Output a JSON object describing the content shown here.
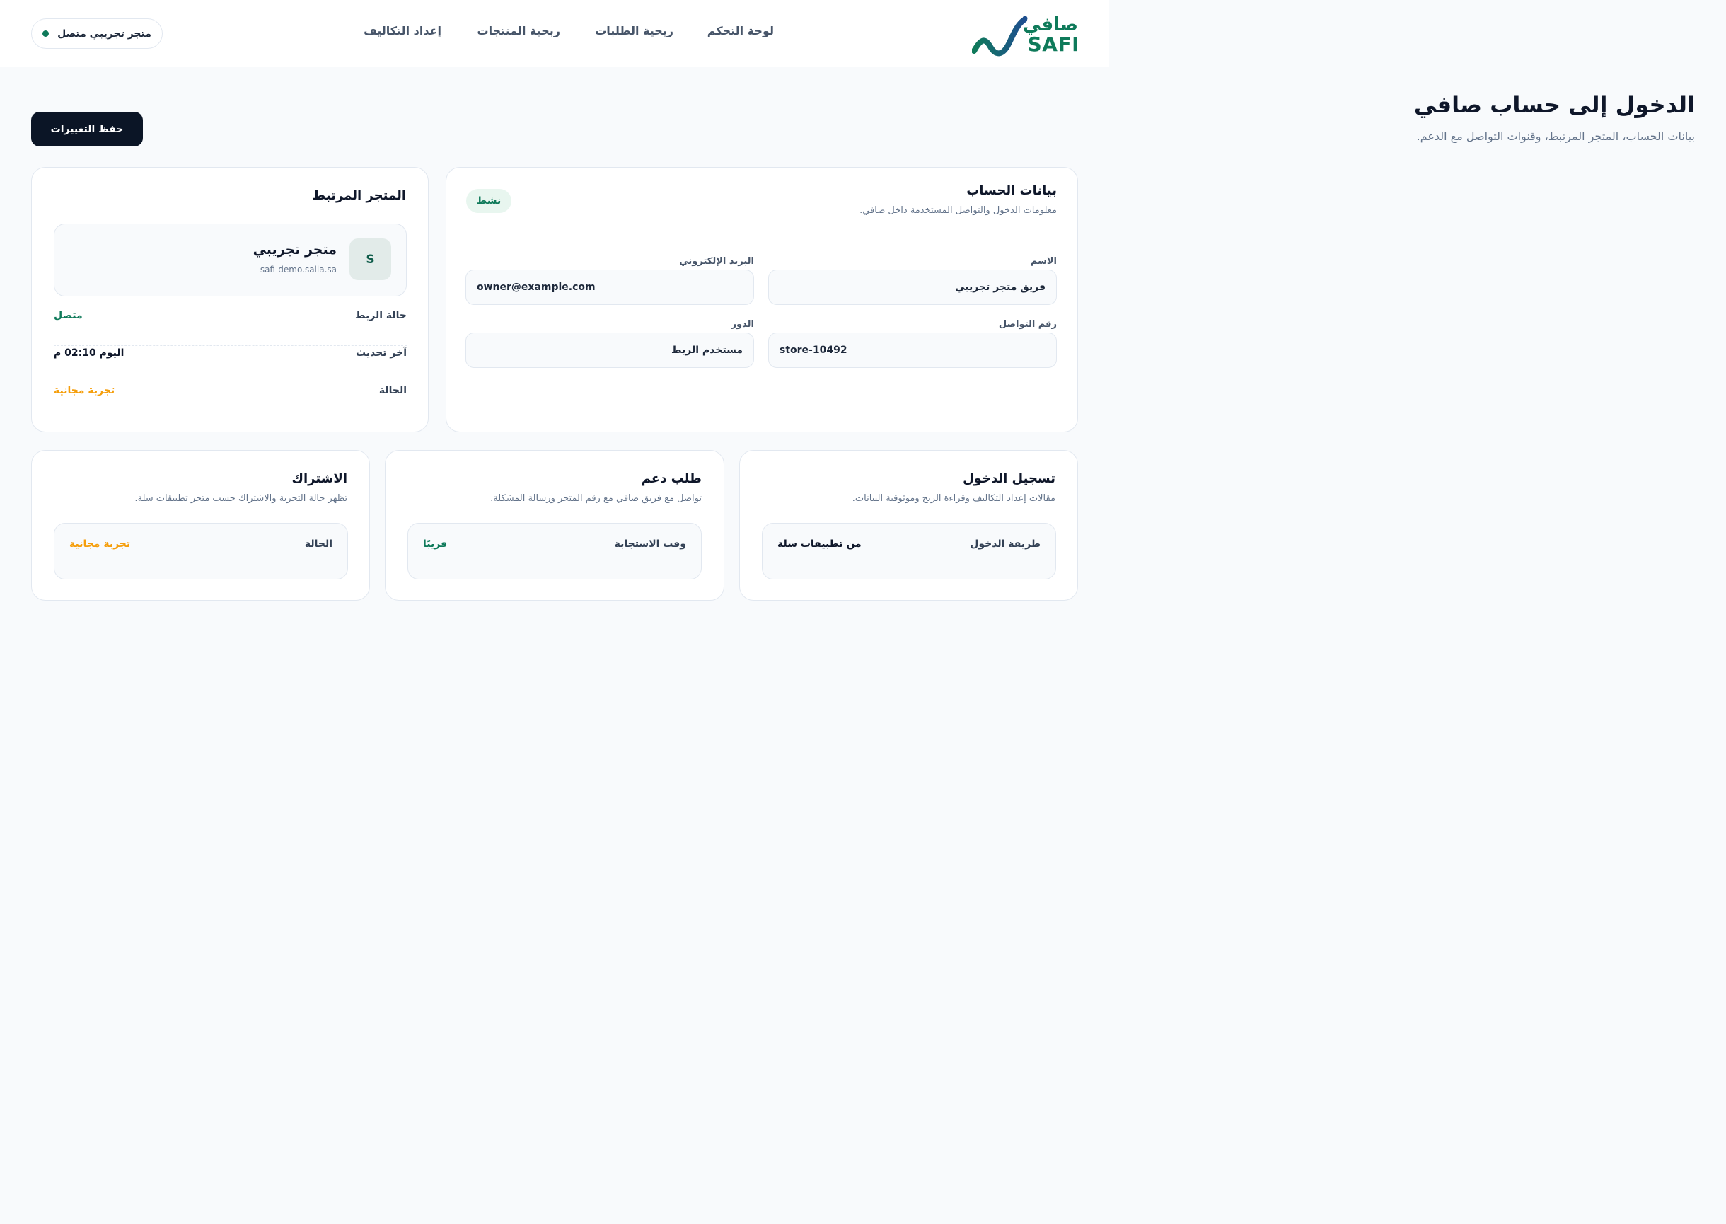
{
  "brand": {
    "name_ar": "صافي",
    "name_en": "SAFI",
    "color": "#0f7a5a",
    "mark_icon": "wave-logo-icon"
  },
  "nav": {
    "items": [
      {
        "label": "لوحة التحكم"
      },
      {
        "label": "ربحية الطلبات"
      },
      {
        "label": "ربحية المنتجات"
      },
      {
        "label": "إعداد التكاليف"
      }
    ]
  },
  "store_status": {
    "label": "متجر تجريبي متصل",
    "dot_color": "#0f7a5a"
  },
  "header": {
    "title": "الدخول إلى حساب صافي",
    "subtitle": "بيانات الحساب، المتجر المرتبط، وقنوات التواصل مع الدعم.",
    "save_label": "حفظ التغييرات"
  },
  "account": {
    "title": "بيانات الحساب",
    "description": "معلومات الدخول والتواصل المستخدمة داخل صافي.",
    "status_badge": "نشط",
    "fields": {
      "name": {
        "label": "الاسم",
        "value": "فريق متجر تجريبي"
      },
      "email": {
        "label": "البريد الإلكتروني",
        "value": "owner@example.com"
      },
      "phone": {
        "label": "رقم التواصل",
        "value": "store-10492"
      },
      "role": {
        "label": "الدور",
        "value": "مستخدم الربط"
      }
    }
  },
  "linked_store": {
    "title": "المتجر المرتبط",
    "avatar_letter": "S",
    "store_name": "متجر تجريبي",
    "domain": "safi-demo.salla.sa",
    "rows": [
      {
        "key": "حالة الربط",
        "value": "متصل"
      },
      {
        "key": "آخر تحديث",
        "value": "اليوم 02:10 م"
      },
      {
        "key": "الحالة",
        "value": "تجربة مجانية"
      }
    ]
  },
  "login_card": {
    "title": "تسجيل الدخول",
    "description": "مقالات إعداد التكاليف وقراءة الربح وموثوقية البيانات.",
    "key": "طريقة الدخول",
    "value": "من تطبيقات سلة"
  },
  "support_card": {
    "title": "طلب دعم",
    "description": "تواصل مع فريق صافي مع رقم المتجر ورسالة المشكلة.",
    "key": "وقت الاستجابة",
    "value": "قريبًا"
  },
  "subscription_card": {
    "title": "الاشتراك",
    "description": "تظهر حالة التجربة والاشتراك حسب متجر تطبيقات سلة.",
    "key": "الحالة",
    "value": "تجربة مجانية"
  },
  "colors": {
    "accent_green": "#0f7a5a",
    "trial_orange": "#f59e0b",
    "primary_button": "#0b1526"
  }
}
